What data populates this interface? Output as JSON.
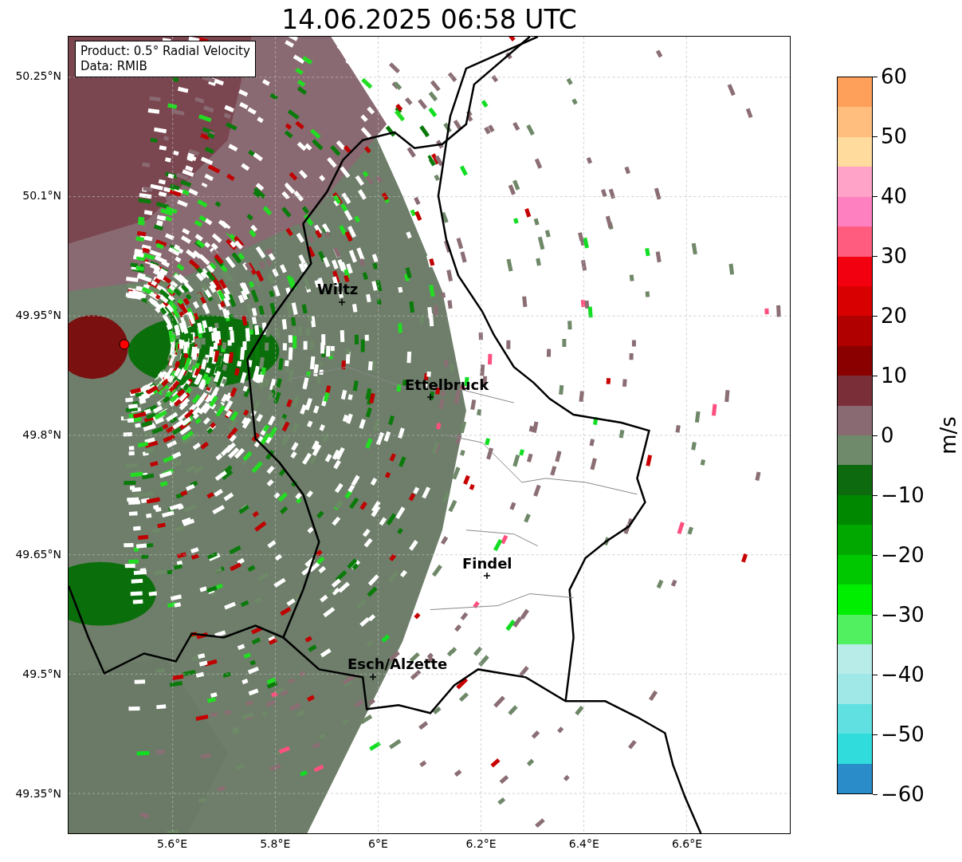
{
  "title": "14.06.2025 06:58 UTC",
  "info_box": {
    "lines": [
      "Product: 0.5° Radial Velocity",
      "Data: RMIB"
    ]
  },
  "map": {
    "lat_ticks": [
      "50.25°N",
      "50.1°N",
      "49.95°N",
      "49.8°N",
      "49.65°N",
      "49.5°N",
      "49.35°N"
    ],
    "lon_ticks": [
      "5.6°E",
      "5.8°E",
      "6°E",
      "6.2°E",
      "6.4°E",
      "6.6°E"
    ],
    "cities": [
      {
        "name": "Wiltz"
      },
      {
        "name": "Ettelbruck"
      },
      {
        "name": "Findel"
      },
      {
        "name": "Esch/Alzette"
      }
    ]
  },
  "colorbar": {
    "label": "m/s",
    "ticks": [
      "60",
      "50",
      "40",
      "30",
      "20",
      "10",
      "0",
      "−10",
      "−20",
      "−30",
      "−40",
      "−50",
      "−60"
    ],
    "bands": [
      {
        "color": "#ffa05a"
      },
      {
        "color": "#ffbe7d"
      },
      {
        "color": "#ffdb9e"
      },
      {
        "color": "#ffa3c8"
      },
      {
        "color": "#ff80c0"
      },
      {
        "color": "#ff5c80"
      },
      {
        "color": "#f20010"
      },
      {
        "color": "#d80000"
      },
      {
        "color": "#b00000"
      },
      {
        "color": "#8a0000"
      },
      {
        "color": "#7a2f38"
      },
      {
        "color": "#8a6a72"
      },
      {
        "color": "#6e8a6a"
      },
      {
        "color": "#0e6a0e"
      },
      {
        "color": "#008800"
      },
      {
        "color": "#00a800"
      },
      {
        "color": "#00c800"
      },
      {
        "color": "#00ee00"
      },
      {
        "color": "#50f060"
      },
      {
        "color": "#b8ece8"
      },
      {
        "color": "#a0e8e8"
      },
      {
        "color": "#60e0e0"
      },
      {
        "color": "#30dcdc"
      },
      {
        "color": "#2a8cc8"
      }
    ]
  }
}
